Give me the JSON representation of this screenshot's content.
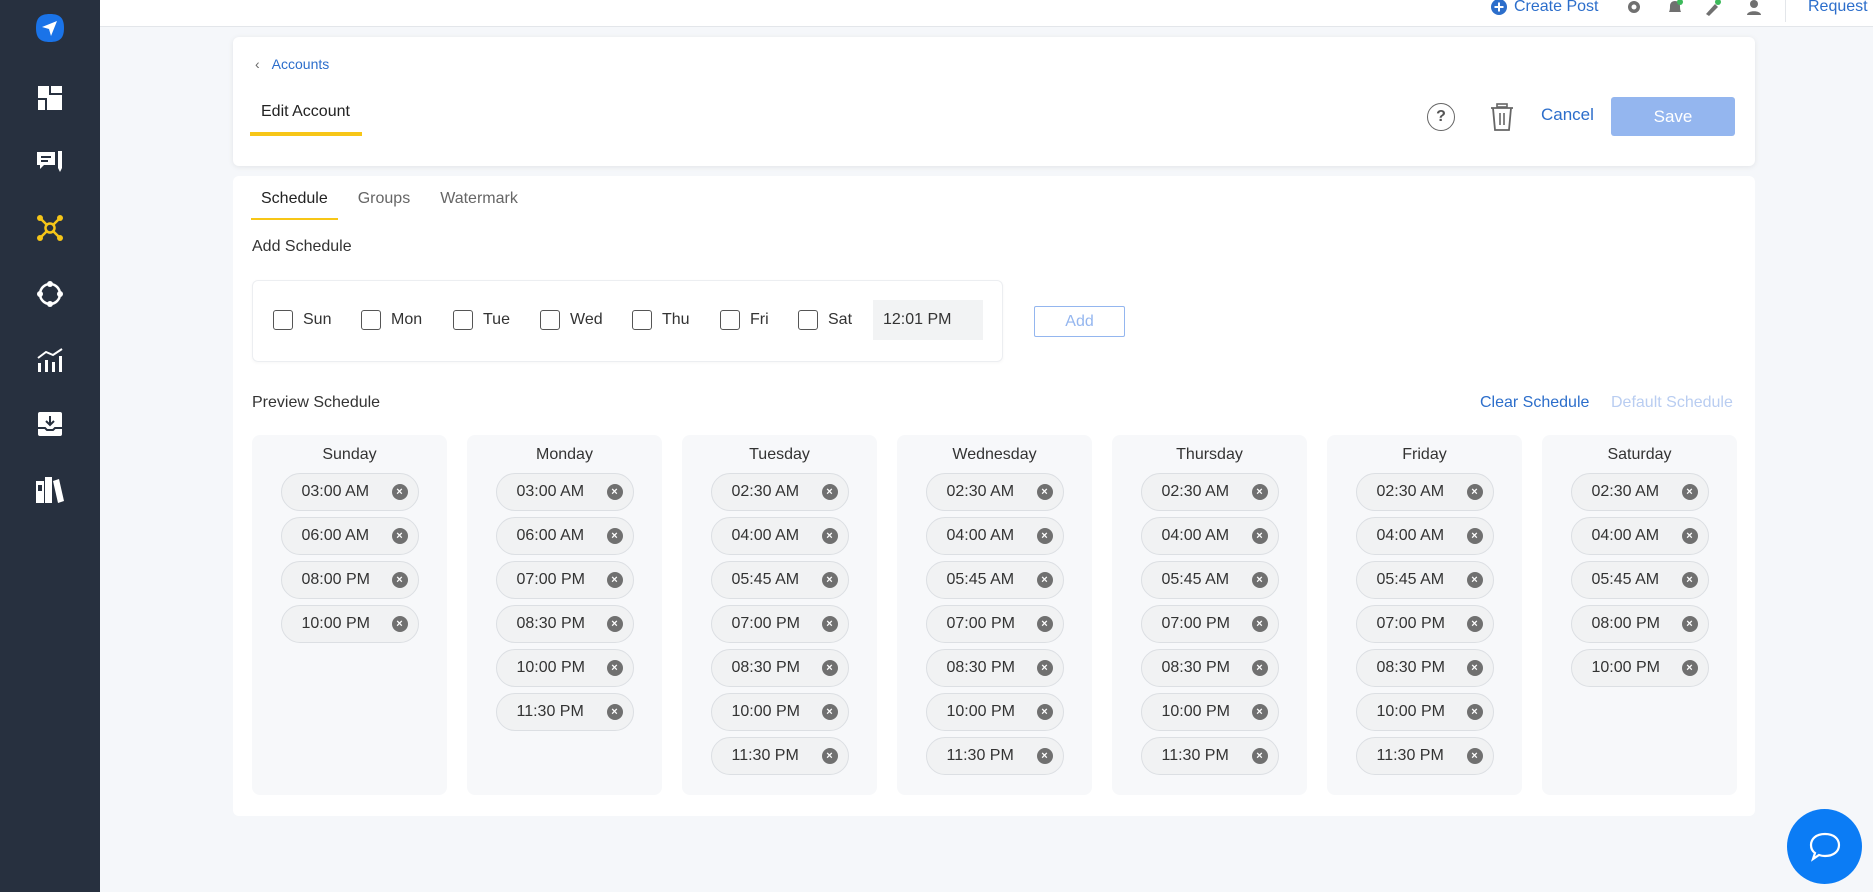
{
  "sidebar": {
    "items": [
      {
        "name": "logo",
        "icon": "paper-plane-icon",
        "color": "#1a73e8"
      },
      {
        "name": "dashboard",
        "icon": "dashboard-grid-icon",
        "color": "#ffffff"
      },
      {
        "name": "compose",
        "icon": "message-edit-icon",
        "color": "#ffffff"
      },
      {
        "name": "accounts",
        "icon": "network-hub-icon",
        "color": "#f5c518",
        "active": true
      },
      {
        "name": "integrations",
        "icon": "circle-nodes-icon",
        "color": "#ffffff"
      },
      {
        "name": "analytics",
        "icon": "bar-line-chart-icon",
        "color": "#ffffff"
      },
      {
        "name": "inbox",
        "icon": "download-tray-icon",
        "color": "#ffffff"
      },
      {
        "name": "library",
        "icon": "books-icon",
        "color": "#ffffff"
      }
    ]
  },
  "topbar": {
    "create_post": "Create Post",
    "icons": [
      "gear-icon",
      "bell-icon",
      "rocket-icon",
      "user-icon"
    ],
    "request_feature": "Request New Feature"
  },
  "header": {
    "breadcrumb": "Accounts",
    "title": "Edit Account",
    "help": "?",
    "cancel": "Cancel",
    "save": "Save"
  },
  "tabs": [
    {
      "label": "Schedule",
      "active": true
    },
    {
      "label": "Groups",
      "active": false
    },
    {
      "label": "Watermark",
      "active": false
    }
  ],
  "add_schedule": {
    "label": "Add Schedule",
    "days": [
      {
        "label": "Sun",
        "checked": false
      },
      {
        "label": "Mon",
        "checked": false
      },
      {
        "label": "Tue",
        "checked": false
      },
      {
        "label": "Wed",
        "checked": false
      },
      {
        "label": "Thu",
        "checked": false
      },
      {
        "label": "Fri",
        "checked": false
      },
      {
        "label": "Sat",
        "checked": false
      }
    ],
    "time": "12:01 PM",
    "add_button": "Add"
  },
  "preview": {
    "label": "Preview Schedule",
    "clear": "Clear Schedule",
    "default": "Default Schedule",
    "columns": [
      {
        "day": "Sunday",
        "times": [
          "03:00 AM",
          "06:00 AM",
          "08:00 PM",
          "10:00 PM"
        ]
      },
      {
        "day": "Monday",
        "times": [
          "03:00 AM",
          "06:00 AM",
          "07:00 PM",
          "08:30 PM",
          "10:00 PM",
          "11:30 PM"
        ]
      },
      {
        "day": "Tuesday",
        "times": [
          "02:30 AM",
          "04:00 AM",
          "05:45 AM",
          "07:00 PM",
          "08:30 PM",
          "10:00 PM",
          "11:30 PM"
        ]
      },
      {
        "day": "Wednesday",
        "times": [
          "02:30 AM",
          "04:00 AM",
          "05:45 AM",
          "07:00 PM",
          "08:30 PM",
          "10:00 PM",
          "11:30 PM"
        ]
      },
      {
        "day": "Thursday",
        "times": [
          "02:30 AM",
          "04:00 AM",
          "05:45 AM",
          "07:00 PM",
          "08:30 PM",
          "10:00 PM",
          "11:30 PM"
        ]
      },
      {
        "day": "Friday",
        "times": [
          "02:30 AM",
          "04:00 AM",
          "05:45 AM",
          "07:00 PM",
          "08:30 PM",
          "10:00 PM",
          "11:30 PM"
        ]
      },
      {
        "day": "Saturday",
        "times": [
          "02:30 AM",
          "04:00 AM",
          "05:45 AM",
          "08:00 PM",
          "10:00 PM"
        ]
      }
    ]
  },
  "colors": {
    "accent": "#2c6ecb",
    "highlight": "#f7c617",
    "sidebar_bg": "#27303f",
    "save_disabled": "#94b6ef",
    "chat": "#0b7cf5"
  }
}
